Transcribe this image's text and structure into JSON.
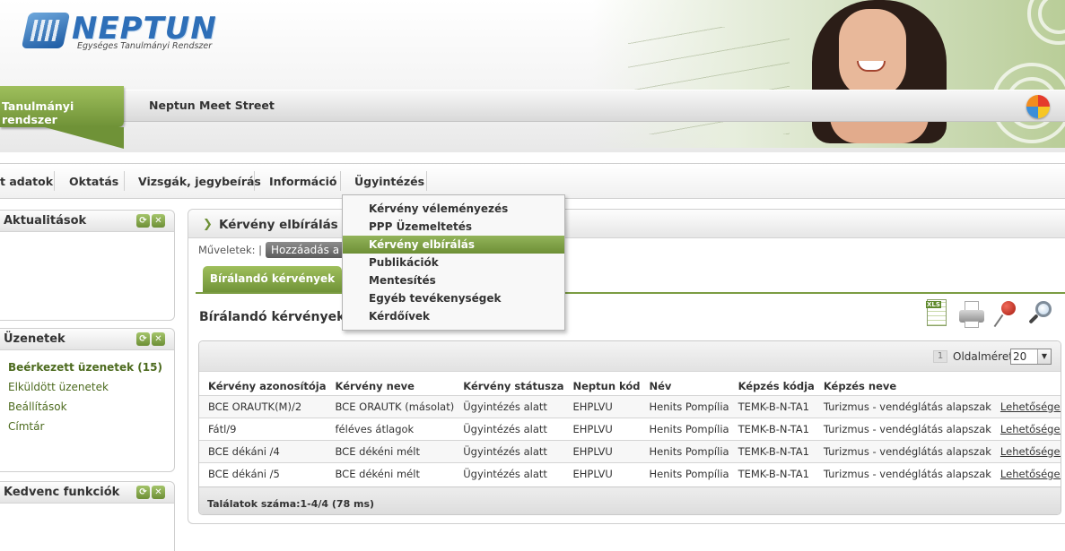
{
  "header": {
    "logo_text": "NEPTUN",
    "logo_subtitle": "Egységes Tanulmányi Rendszer",
    "tabs": [
      {
        "label": "Tanulmányi rendszer"
      },
      {
        "label": "Neptun Meet Street"
      }
    ]
  },
  "menu": {
    "items": [
      {
        "label": "t adatok"
      },
      {
        "label": "Oktatás"
      },
      {
        "label": "Vizsgák, jegybeírás"
      },
      {
        "label": "Információ"
      },
      {
        "label": "Ügyintézés"
      }
    ]
  },
  "dropdown": {
    "items": [
      {
        "label": "Kérvény véleményezés"
      },
      {
        "label": "PPP Üzemeltetés"
      },
      {
        "label": "Kérvény elbírálás"
      },
      {
        "label": "Publikációk"
      },
      {
        "label": "Mentesítés"
      },
      {
        "label": "Egyéb tevékenységek"
      },
      {
        "label": "Kérdőívek"
      }
    ],
    "active_index": 2
  },
  "panels": {
    "aktualitasok": {
      "title": "Aktualitások"
    },
    "uzenetek": {
      "title": "Üzenetek",
      "links": [
        {
          "label": "Beérkezett üzenetek (15)"
        },
        {
          "label": "Elküldött üzenetek"
        },
        {
          "label": "Beállítások"
        },
        {
          "label": "Címtár"
        }
      ]
    },
    "kedvenc": {
      "title": "Kedvenc funkciók"
    },
    "btn_refresh": "⟳",
    "btn_close": "✕"
  },
  "content": {
    "title": "Kérvény elbírálás",
    "muveletek_label": "Műveletek: |",
    "hozzaadas_label": "Hozzáadás a",
    "subtab_label": "Bírálandó kérvények",
    "section_title": "Bírálandó kérvények",
    "xls_label": "XLS",
    "page_number": "1",
    "page_size_label": "Oldalméret",
    "page_size_value": "20",
    "footer": "Találatok száma:1-4/4 (78 ms)"
  },
  "table": {
    "columns": [
      "Kérvény azonosítója",
      "Kérvény neve",
      "Kérvény státusza",
      "Neptun kód",
      "Név",
      "Képzés kódja",
      "Képzés neve",
      ""
    ],
    "rows": [
      [
        "BCE ORAUTK(M)/2",
        "BCE ORAUTK (másolat)",
        "Ügyintézés alatt",
        "EHPLVU",
        "Henits Pompília",
        "TEMK-B-N-TA1",
        "Turizmus - vendéglátás alapszak",
        "Lehetőségek"
      ],
      [
        "Fátl/9",
        "féléves átlagok",
        "Ügyintézés alatt",
        "EHPLVU",
        "Henits Pompília",
        "TEMK-B-N-TA1",
        "Turizmus - vendéglátás alapszak",
        "Lehetőségek"
      ],
      [
        "BCE dékáni /4",
        "BCE dékéni mélt",
        "Ügyintézés alatt",
        "EHPLVU",
        "Henits Pompília",
        "TEMK-B-N-TA1",
        "Turizmus - vendéglátás alapszak",
        "Lehetőségek"
      ],
      [
        "BCE dékáni /5",
        "BCE dékéni mélt",
        "Ügyintézés alatt",
        "EHPLVU",
        "Henits Pompília",
        "TEMK-B-N-TA1",
        "Turizmus - vendéglátás alapszak",
        "Lehetőségek"
      ]
    ]
  }
}
